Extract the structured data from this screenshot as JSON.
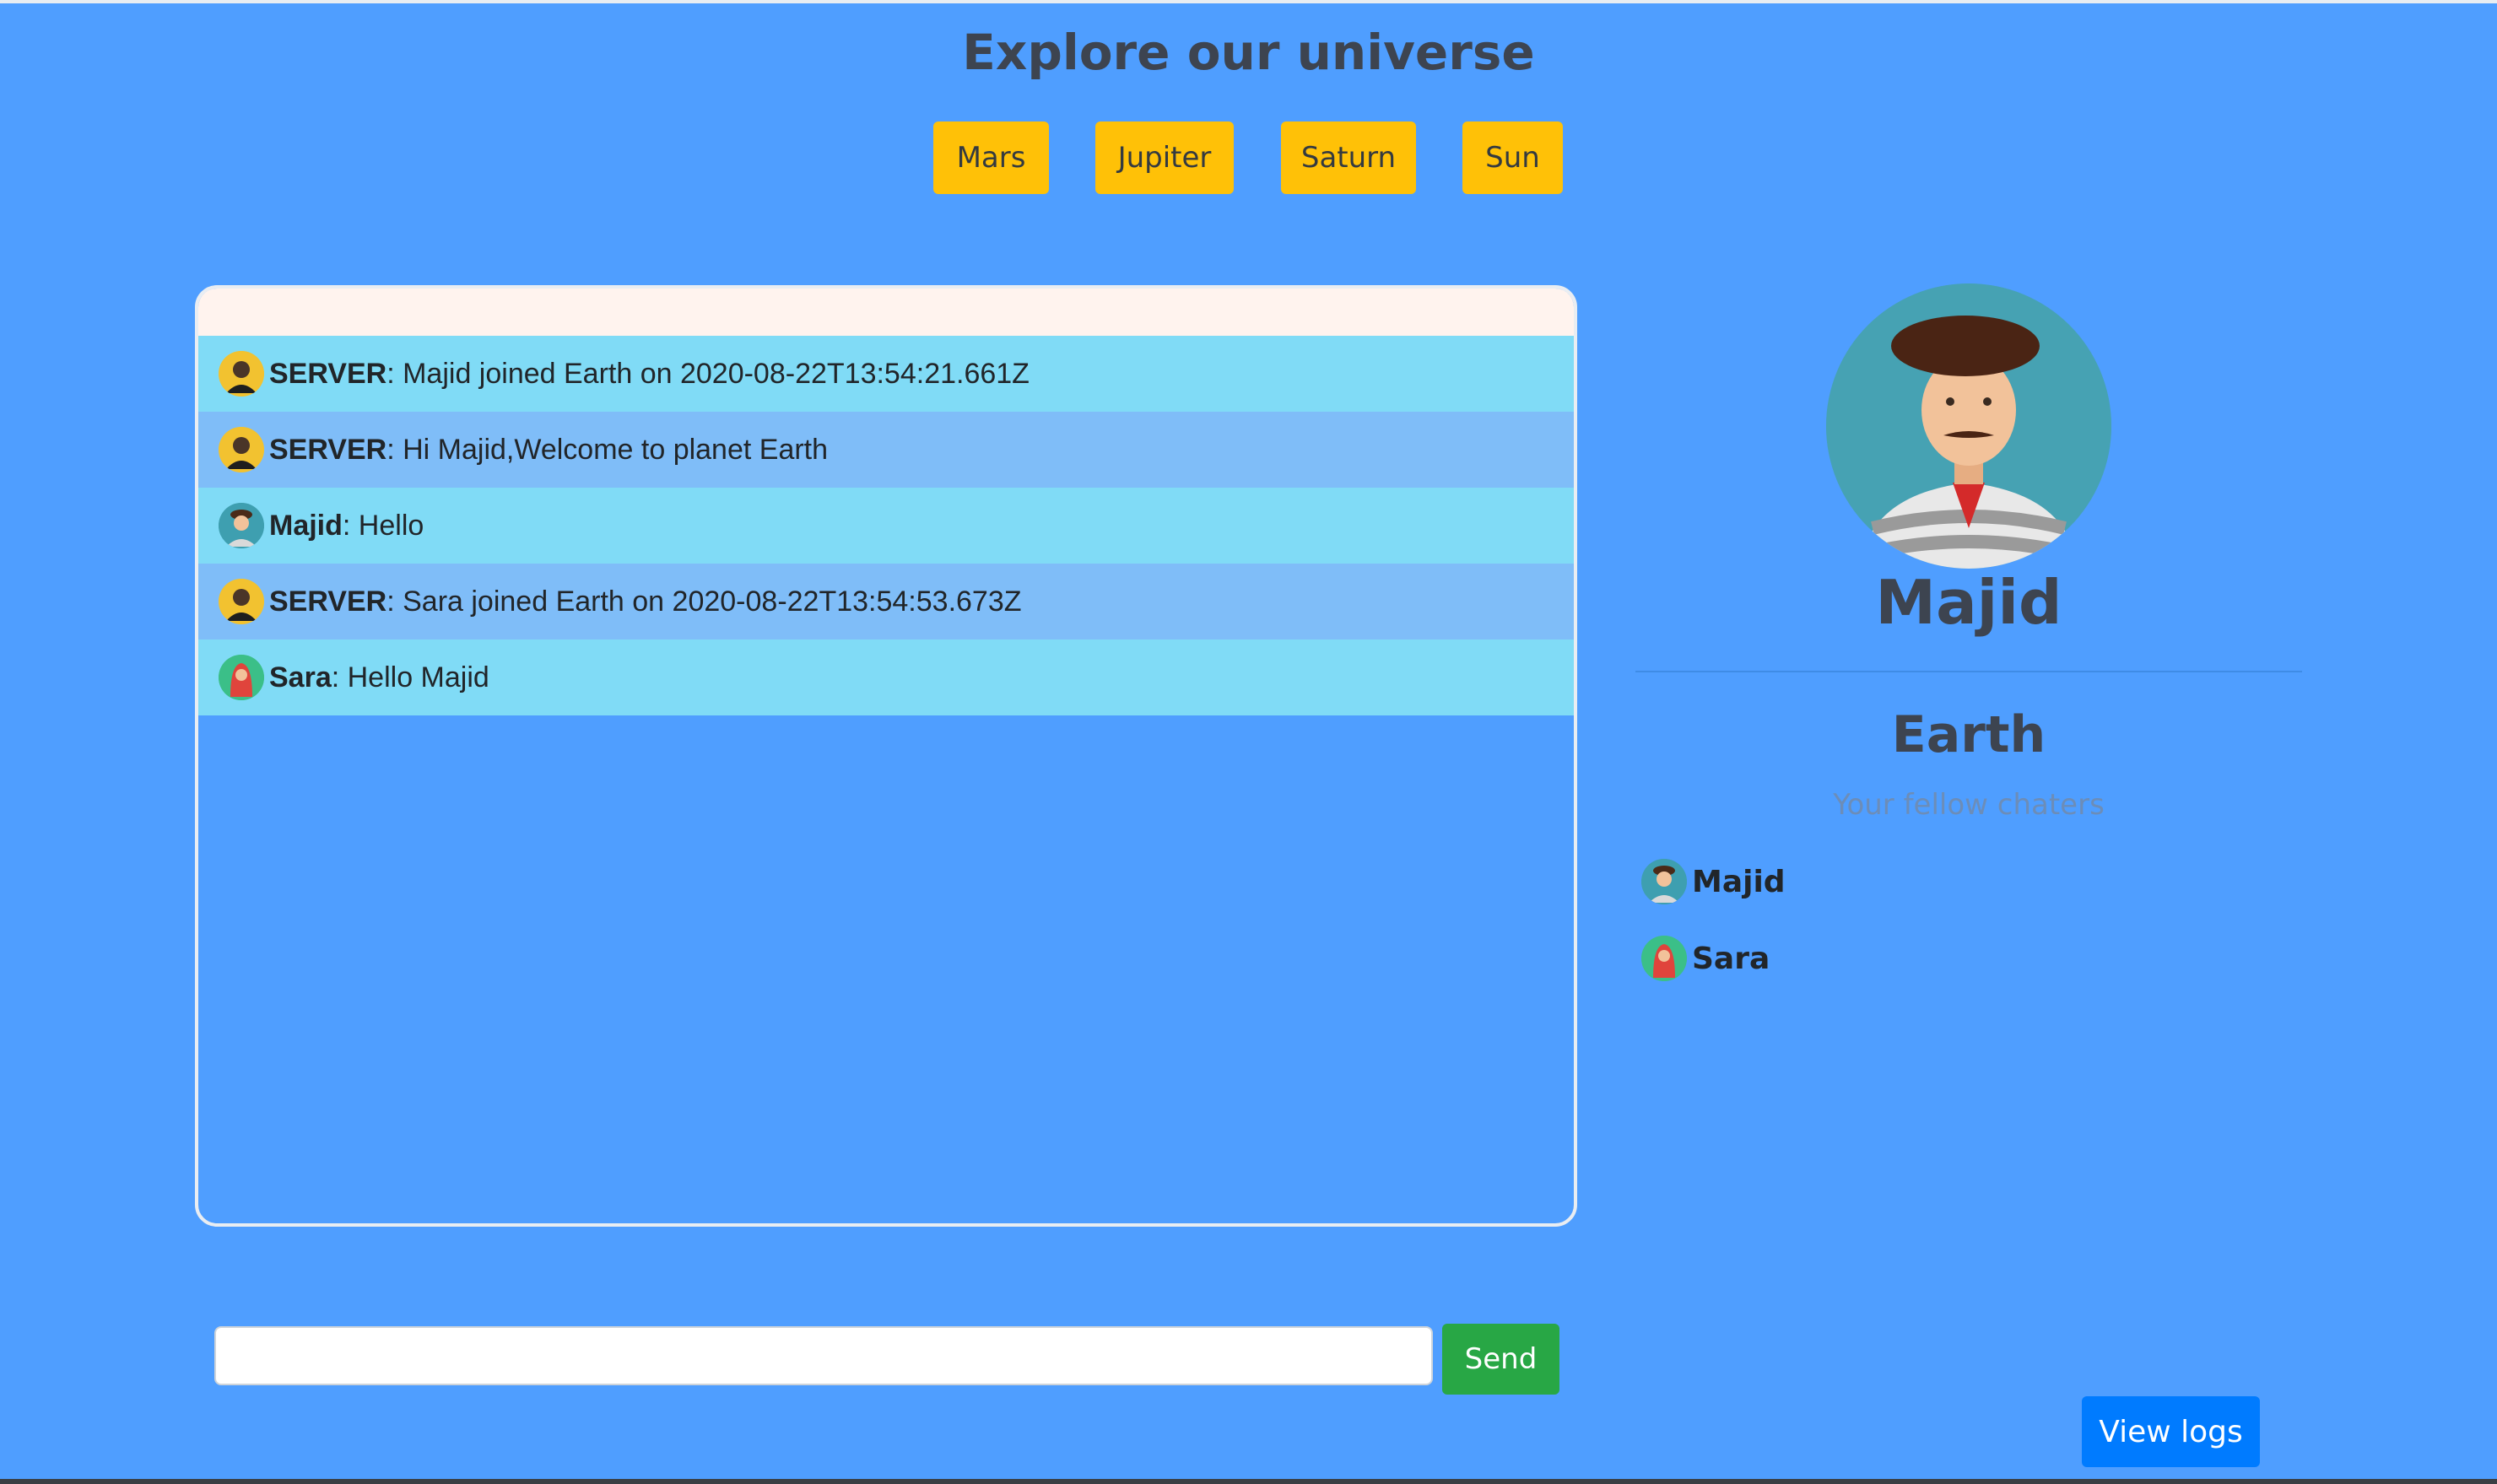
{
  "header": {
    "title": "Explore our universe"
  },
  "planets": [
    "Mars",
    "Jupiter",
    "Saturn",
    "Sun"
  ],
  "messages": [
    {
      "sender": "SERVER",
      "text": ": Majid joined Earth on 2020-08-22T13:54:21.661Z",
      "avatar": "server-avatar-icon"
    },
    {
      "sender": "SERVER",
      "text": ": Hi Majid,Welcome to planet Earth",
      "avatar": "server-avatar-icon"
    },
    {
      "sender": "Majid",
      "text": ": Hello",
      "avatar": "majid-avatar-icon"
    },
    {
      "sender": "SERVER",
      "text": ": Sara joined Earth on 2020-08-22T13:54:53.673Z",
      "avatar": "server-avatar-icon"
    },
    {
      "sender": "Sara",
      "text": ": Hello Majid",
      "avatar": "sara-avatar-icon"
    }
  ],
  "composer": {
    "value": "",
    "send_label": "Send"
  },
  "profile": {
    "name": "Majid",
    "room": "Earth",
    "subtitle": "Your fellow chaters"
  },
  "users": [
    {
      "name": "Majid",
      "avatar": "majid-avatar-icon"
    },
    {
      "name": "Sara",
      "avatar": "sara-avatar-icon"
    }
  ],
  "footer": {
    "logs_label": "View logs"
  },
  "colors": {
    "background": "#4f9eff",
    "planet_button": "#ffc107",
    "send_button": "#28a745",
    "logs_button": "#007bff",
    "row_odd": "#80dbf6",
    "row_even": "#7fbdf8"
  }
}
